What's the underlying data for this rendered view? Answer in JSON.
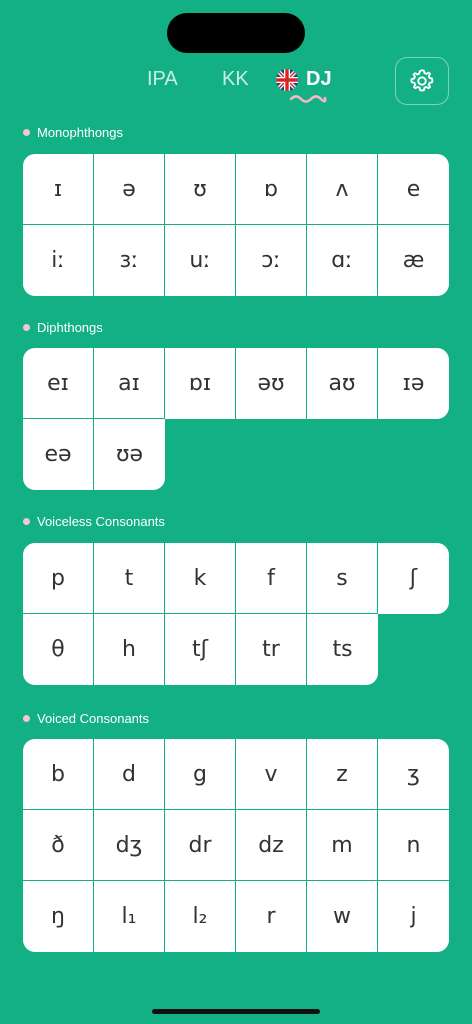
{
  "tabs": [
    {
      "label": "IPA"
    },
    {
      "label": "KK"
    },
    {
      "label": "DJ"
    }
  ],
  "active_tab": "DJ",
  "accent_color": "#12b084",
  "sections": [
    {
      "title": "Monophthongs",
      "symbols": [
        "ɪ",
        "ə",
        "ʊ",
        "ɒ",
        "ʌ",
        "e",
        "iː",
        "ɜː",
        "uː",
        "ɔː",
        "ɑː",
        "æ"
      ]
    },
    {
      "title": "Diphthongs",
      "symbols": [
        "eɪ",
        "aɪ",
        "ɒɪ",
        "əʊ",
        "aʊ",
        "ɪə",
        "eə",
        "ʊə"
      ]
    },
    {
      "title": "Voiceless Consonants",
      "symbols": [
        "p",
        "t",
        "k",
        "f",
        "s",
        "ʃ",
        "θ",
        "h",
        "tʃ",
        "tr",
        "ts"
      ]
    },
    {
      "title": "Voiced Consonants",
      "symbols": [
        "b",
        "d",
        "g",
        "v",
        "z",
        "ʒ",
        "ð",
        "dʒ",
        "dr",
        "dz",
        "m",
        "n",
        "ŋ",
        "l₁",
        "l₂",
        "r",
        "w",
        "j"
      ]
    }
  ]
}
